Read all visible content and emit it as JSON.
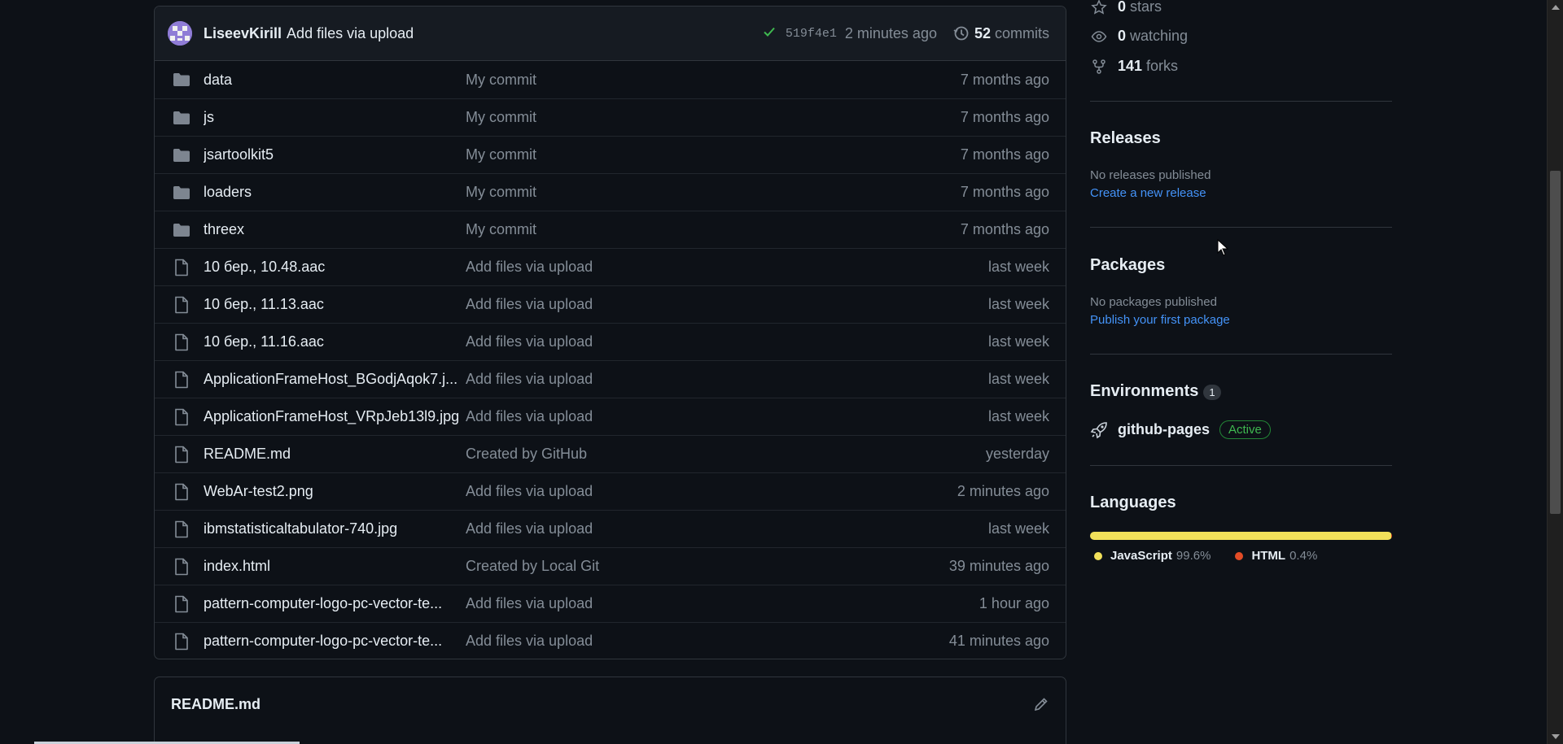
{
  "commit": {
    "author": "LiseevKirill",
    "message": "Add files via upload",
    "sha": "519f4e1",
    "ago": "2 minutes ago",
    "commits_count": "52",
    "commits_label": "commits"
  },
  "files": [
    {
      "type": "folder",
      "name": "data",
      "message": "My commit",
      "age": "7 months ago"
    },
    {
      "type": "folder",
      "name": "js",
      "message": "My commit",
      "age": "7 months ago"
    },
    {
      "type": "folder",
      "name": "jsartoolkit5",
      "message": "My commit",
      "age": "7 months ago"
    },
    {
      "type": "folder",
      "name": "loaders",
      "message": "My commit",
      "age": "7 months ago"
    },
    {
      "type": "folder",
      "name": "threex",
      "message": "My commit",
      "age": "7 months ago"
    },
    {
      "type": "file",
      "name": "10 бер., 10.48.aac",
      "message": "Add files via upload",
      "age": "last week"
    },
    {
      "type": "file",
      "name": "10 бер., 11.13.aac",
      "message": "Add files via upload",
      "age": "last week"
    },
    {
      "type": "file",
      "name": "10 бер., 11.16.aac",
      "message": "Add files via upload",
      "age": "last week"
    },
    {
      "type": "file",
      "name": "ApplicationFrameHost_BGodjAqok7.j...",
      "message": "Add files via upload",
      "age": "last week"
    },
    {
      "type": "file",
      "name": "ApplicationFrameHost_VRpJeb13l9.jpg",
      "message": "Add files via upload",
      "age": "last week"
    },
    {
      "type": "file",
      "name": "README.md",
      "message": "Created by GitHub",
      "age": "yesterday"
    },
    {
      "type": "file",
      "name": "WebAr-test2.png",
      "message": "Add files via upload",
      "age": "2 minutes ago"
    },
    {
      "type": "file",
      "name": "ibmstatisticaltabulator-740.jpg",
      "message": "Add files via upload",
      "age": "last week"
    },
    {
      "type": "file",
      "name": "index.html",
      "message": "Created by Local Git",
      "age": "39 minutes ago"
    },
    {
      "type": "file",
      "name": "pattern-computer-logo-pc-vector-te...",
      "message": "Add files via upload",
      "age": "1 hour ago"
    },
    {
      "type": "file",
      "name": "pattern-computer-logo-pc-vector-te...",
      "message": "Add files via upload",
      "age": "41 minutes ago"
    }
  ],
  "readme": {
    "title": "README.md"
  },
  "sidebar": {
    "stars": {
      "count": "0",
      "label": "stars"
    },
    "watching": {
      "count": "0",
      "label": "watching"
    },
    "forks": {
      "count": "141",
      "label": "forks"
    },
    "releases": {
      "title": "Releases",
      "empty": "No releases published",
      "link": "Create a new release"
    },
    "packages": {
      "title": "Packages",
      "empty": "No packages published",
      "link": "Publish your first package"
    },
    "environments": {
      "title": "Environments",
      "count": "1",
      "name": "github-pages",
      "status": "Active"
    },
    "languages": {
      "title": "Languages",
      "items": [
        {
          "name": "JavaScript",
          "percent": "99.6%",
          "share": 99.6,
          "color": "#f1e05a"
        },
        {
          "name": "HTML",
          "percent": "0.4%",
          "share": 0.4,
          "color": "#e34c26"
        }
      ]
    }
  }
}
